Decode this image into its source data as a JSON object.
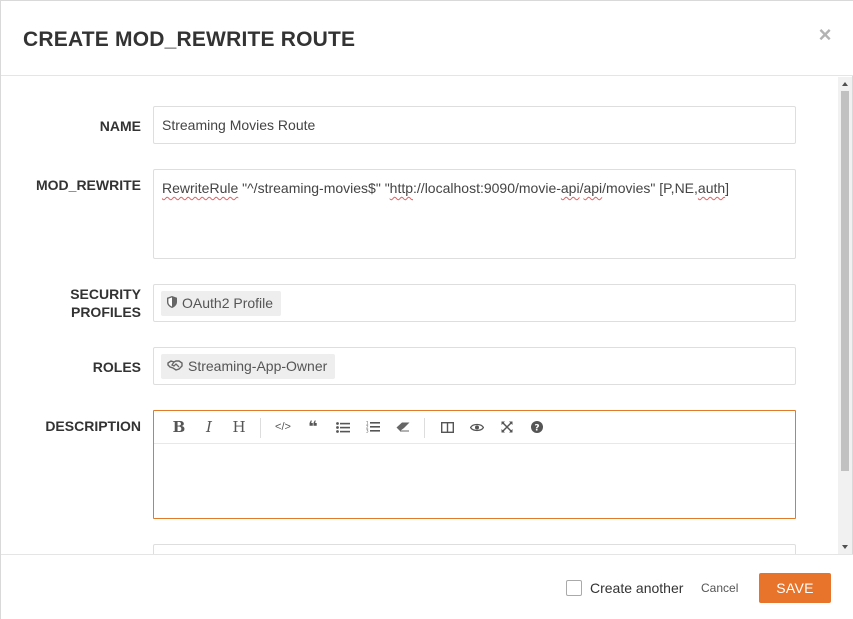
{
  "dialog": {
    "title": "CREATE MOD_REWRITE ROUTE",
    "close_icon": "close-icon"
  },
  "form": {
    "name": {
      "label": "NAME",
      "value": "Streaming Movies Route"
    },
    "mod_rewrite": {
      "label": "MOD_REWRITE",
      "value_parts": [
        {
          "text": "RewriteRule",
          "squiggle": true
        },
        {
          "text": " \"^/streaming-movies$\" \"",
          "squiggle": false
        },
        {
          "text": "http",
          "squiggle": true
        },
        {
          "text": "://localhost:9090/movie-",
          "squiggle": false
        },
        {
          "text": "api",
          "squiggle": true
        },
        {
          "text": "/",
          "squiggle": false
        },
        {
          "text": "api",
          "squiggle": true
        },
        {
          "text": "/movies\" [P,NE,",
          "squiggle": false
        },
        {
          "text": "auth",
          "squiggle": true
        },
        {
          "text": "]",
          "squiggle": false
        }
      ]
    },
    "security_profiles": {
      "label_line1": "SECURITY",
      "label_line2": "PROFILES",
      "chips": [
        {
          "label": "OAuth2 Profile",
          "icon": "shield-icon"
        }
      ]
    },
    "roles": {
      "label": "ROLES",
      "chips": [
        {
          "label": "Streaming-App-Owner",
          "icon": "handshake-icon"
        }
      ]
    },
    "description": {
      "label": "DESCRIPTION",
      "toolbar": [
        "bold-icon",
        "italic-icon",
        "heading-icon",
        "code-icon",
        "quote-icon",
        "unordered-list-icon",
        "ordered-list-icon",
        "eraser-icon",
        "side-by-side-icon",
        "preview-icon",
        "fullscreen-icon",
        "help-icon"
      ],
      "value": ""
    }
  },
  "footer": {
    "create_another_label": "Create another",
    "create_another_checked": false,
    "cancel_label": "Cancel",
    "save_label": "SAVE"
  },
  "colors": {
    "accent": "#e8742b",
    "title": "#333333",
    "border": "#dedede"
  }
}
